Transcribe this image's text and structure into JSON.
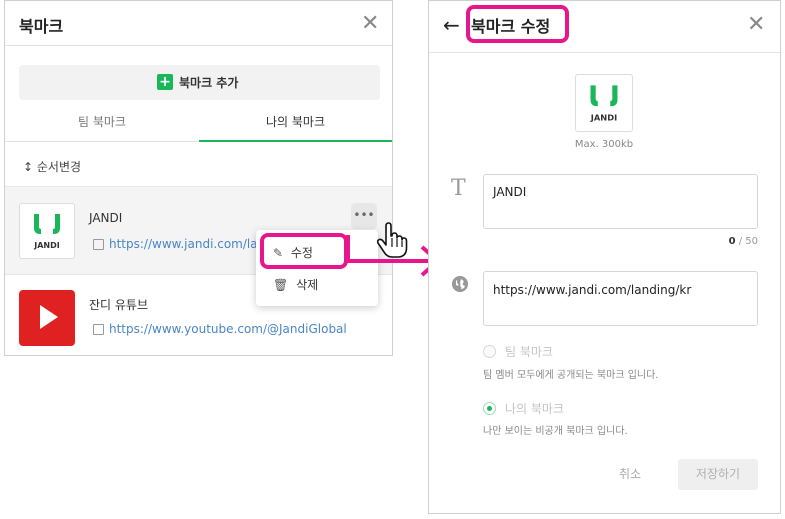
{
  "left_panel": {
    "title": "북마크",
    "add_button_label": "북마크 추가",
    "tabs": [
      {
        "label": "팀 북마크"
      },
      {
        "label": "나의 북마크"
      }
    ],
    "reorder_label": "순서변경",
    "items": [
      {
        "name": "JANDI",
        "url": "https://www.jandi.com/landing/kr",
        "logo_text": "JANDI"
      },
      {
        "name": "잔디 유튜브",
        "url": "https://www.youtube.com/@JandiGlobal"
      }
    ],
    "context_menu": {
      "edit_label": "수정",
      "delete_label": "삭제"
    }
  },
  "right_panel": {
    "title": "북마크 수정",
    "logo_text": "JANDI",
    "max_size_text": "Max. 300kb",
    "name_value": "JANDI",
    "char_count_current": "0",
    "char_count_max": " / 50",
    "url_value": "https://www.jandi.com/landing/kr",
    "visibility_options": [
      {
        "label": "팀 북마크",
        "description": "팀 멤버 모두에게 공개되는 북마크 입니다.",
        "selected": false
      },
      {
        "label": "나의 북마크",
        "description": "나만 보이는 비공개 북마크 입니다.",
        "selected": true
      }
    ],
    "cancel_label": "취소",
    "save_label": "저장하기"
  },
  "colors": {
    "accent_green": "#1ab75a",
    "highlight_pink": "#e8168c",
    "link_blue": "#4a86c5"
  }
}
